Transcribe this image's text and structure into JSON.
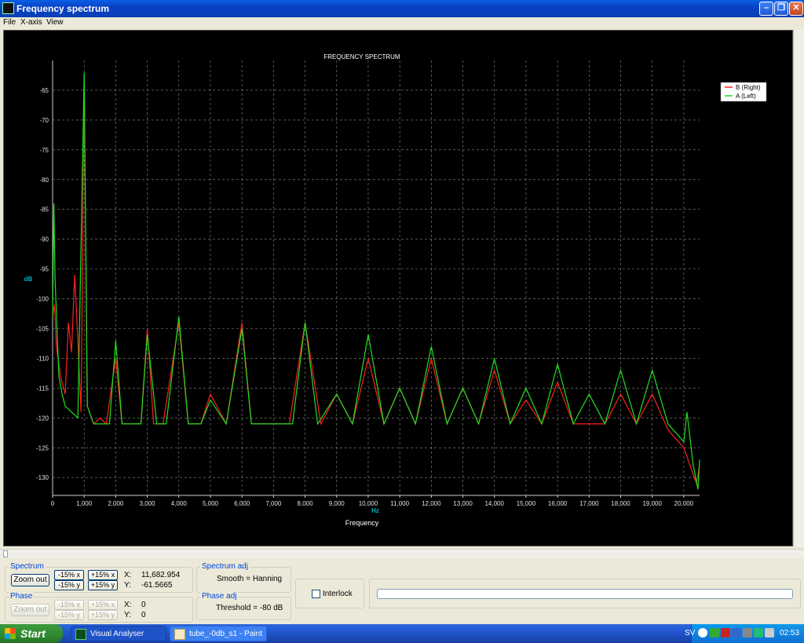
{
  "window": {
    "title": "Frequency spectrum",
    "minimize_glyph": "–",
    "restore_glyph": "❐",
    "close_glyph": "✕"
  },
  "menu": [
    "File",
    "X-axis",
    "View"
  ],
  "chart_data": {
    "type": "line",
    "title": "FREQUENCY SPECTRUM",
    "xlabel": "Frequency",
    "xunit": "Hz",
    "ylabel": "dB",
    "xlim": [
      0,
      20500
    ],
    "ylim": [
      -133,
      -60
    ],
    "xticks": [
      0,
      1000,
      2000,
      3000,
      4000,
      5000,
      6000,
      7000,
      8000,
      9000,
      10000,
      11000,
      12000,
      13000,
      14000,
      15000,
      16000,
      17000,
      18000,
      19000,
      20000
    ],
    "xtick_labels": [
      "0",
      "1,000",
      "2,000",
      "3,000",
      "4,000",
      "5,000",
      "6,000",
      "7,000",
      "8,000",
      "9,000",
      "10,000",
      "11,000",
      "12,000",
      "13,000",
      "14,000",
      "15,000",
      "16,000",
      "17,000",
      "18,000",
      "19,000",
      "20,000"
    ],
    "yticks": [
      -65,
      -70,
      -75,
      -80,
      -85,
      -90,
      -95,
      -100,
      -105,
      -110,
      -115,
      -120,
      -125,
      -130
    ],
    "ytick_labels": [
      "-65",
      "-70",
      "-75",
      "-80",
      "-85",
      "-90",
      "-95",
      "-100",
      "-105",
      "-110",
      "-115",
      "-120",
      "-125",
      "-130"
    ],
    "grid": true,
    "legend_position": "top-right",
    "series": [
      {
        "name": "B (Right)",
        "color": "#ff2020",
        "points": [
          [
            0,
            -103
          ],
          [
            60,
            -101
          ],
          [
            120,
            -108
          ],
          [
            250,
            -113
          ],
          [
            400,
            -116
          ],
          [
            500,
            -104
          ],
          [
            600,
            -109
          ],
          [
            700,
            -96
          ],
          [
            800,
            -107
          ],
          [
            900,
            -119
          ],
          [
            1000,
            -64
          ],
          [
            1100,
            -118
          ],
          [
            1300,
            -121
          ],
          [
            1500,
            -120
          ],
          [
            1700,
            -121
          ],
          [
            2000,
            -110
          ],
          [
            2200,
            -121
          ],
          [
            2500,
            -121
          ],
          [
            2800,
            -121
          ],
          [
            3000,
            -105
          ],
          [
            3200,
            -121
          ],
          [
            3500,
            -121
          ],
          [
            4000,
            -104
          ],
          [
            4300,
            -121
          ],
          [
            4700,
            -121
          ],
          [
            5000,
            -116
          ],
          [
            5500,
            -121
          ],
          [
            6000,
            -104
          ],
          [
            6300,
            -121
          ],
          [
            7000,
            -121
          ],
          [
            7500,
            -121
          ],
          [
            8000,
            -104
          ],
          [
            8500,
            -121
          ],
          [
            9000,
            -116
          ],
          [
            9500,
            -121
          ],
          [
            10000,
            -110
          ],
          [
            10500,
            -121
          ],
          [
            11000,
            -115
          ],
          [
            11500,
            -121
          ],
          [
            12000,
            -110
          ],
          [
            12500,
            -121
          ],
          [
            13000,
            -115
          ],
          [
            13500,
            -121
          ],
          [
            14000,
            -112
          ],
          [
            14500,
            -121
          ],
          [
            15000,
            -117
          ],
          [
            15500,
            -121
          ],
          [
            16000,
            -114
          ],
          [
            16500,
            -121
          ],
          [
            17000,
            -121
          ],
          [
            17500,
            -121
          ],
          [
            18000,
            -116
          ],
          [
            18500,
            -121
          ],
          [
            19000,
            -116
          ],
          [
            19500,
            -122
          ],
          [
            20000,
            -125
          ],
          [
            20200,
            -128
          ],
          [
            20400,
            -131
          ],
          [
            20500,
            -128
          ]
        ]
      },
      {
        "name": "A (Left)",
        "color": "#20e020",
        "points": [
          [
            0,
            -103
          ],
          [
            40,
            -84
          ],
          [
            80,
            -97
          ],
          [
            200,
            -113
          ],
          [
            300,
            -116
          ],
          [
            400,
            -118
          ],
          [
            600,
            -119
          ],
          [
            800,
            -120
          ],
          [
            1000,
            -62
          ],
          [
            1100,
            -118
          ],
          [
            1300,
            -121
          ],
          [
            1500,
            -121
          ],
          [
            1800,
            -121
          ],
          [
            2000,
            -107
          ],
          [
            2200,
            -121
          ],
          [
            2500,
            -121
          ],
          [
            2800,
            -121
          ],
          [
            3000,
            -106
          ],
          [
            3300,
            -121
          ],
          [
            3600,
            -121
          ],
          [
            4000,
            -103
          ],
          [
            4300,
            -121
          ],
          [
            4700,
            -121
          ],
          [
            5000,
            -117
          ],
          [
            5500,
            -121
          ],
          [
            6000,
            -105
          ],
          [
            6300,
            -121
          ],
          [
            6800,
            -121
          ],
          [
            7200,
            -121
          ],
          [
            7600,
            -121
          ],
          [
            8000,
            -104
          ],
          [
            8400,
            -121
          ],
          [
            9000,
            -116
          ],
          [
            9500,
            -121
          ],
          [
            10000,
            -106
          ],
          [
            10500,
            -121
          ],
          [
            11000,
            -115
          ],
          [
            11500,
            -121
          ],
          [
            12000,
            -108
          ],
          [
            12500,
            -121
          ],
          [
            13000,
            -115
          ],
          [
            13500,
            -121
          ],
          [
            14000,
            -110
          ],
          [
            14500,
            -121
          ],
          [
            15000,
            -115
          ],
          [
            15500,
            -121
          ],
          [
            16000,
            -111
          ],
          [
            16500,
            -121
          ],
          [
            17000,
            -116
          ],
          [
            17500,
            -121
          ],
          [
            18000,
            -112
          ],
          [
            18500,
            -121
          ],
          [
            19000,
            -112
          ],
          [
            19500,
            -121
          ],
          [
            20000,
            -124
          ],
          [
            20100,
            -119
          ],
          [
            20300,
            -128
          ],
          [
            20450,
            -132
          ],
          [
            20500,
            -127
          ]
        ]
      }
    ]
  },
  "spectrum_group": {
    "legend": "Spectrum",
    "zoom_out": "Zoom out",
    "minus_x": "-15% x",
    "plus_x": "+15% x",
    "minus_y": "-15% y",
    "plus_y": "+15% y",
    "x_label": "X:",
    "x_value": "11,682.954",
    "y_label": "Y:",
    "y_value": "-61.5665"
  },
  "phase_group": {
    "legend": "Phase",
    "zoom_out": "Zoom out",
    "minus_x": "-15% x",
    "plus_x": "+15% x",
    "minus_y": "-15% y",
    "plus_y": "+15% y",
    "x_label": "X:",
    "x_value": "0",
    "y_label": "Y:",
    "y_value": "0"
  },
  "spectrum_adj": {
    "legend": "Spectrum adj",
    "value": "Smooth = Hanning"
  },
  "phase_adj": {
    "legend": "Phase adj",
    "value": "Threshold = -80 dB"
  },
  "interlock": {
    "label": "Interlock",
    "checked": false
  },
  "taskbar": {
    "start": "Start",
    "tasks": [
      "Visual Analyser",
      "tube_-0db_s1 - Paint"
    ],
    "lang": "SV",
    "clock": "02:53"
  }
}
